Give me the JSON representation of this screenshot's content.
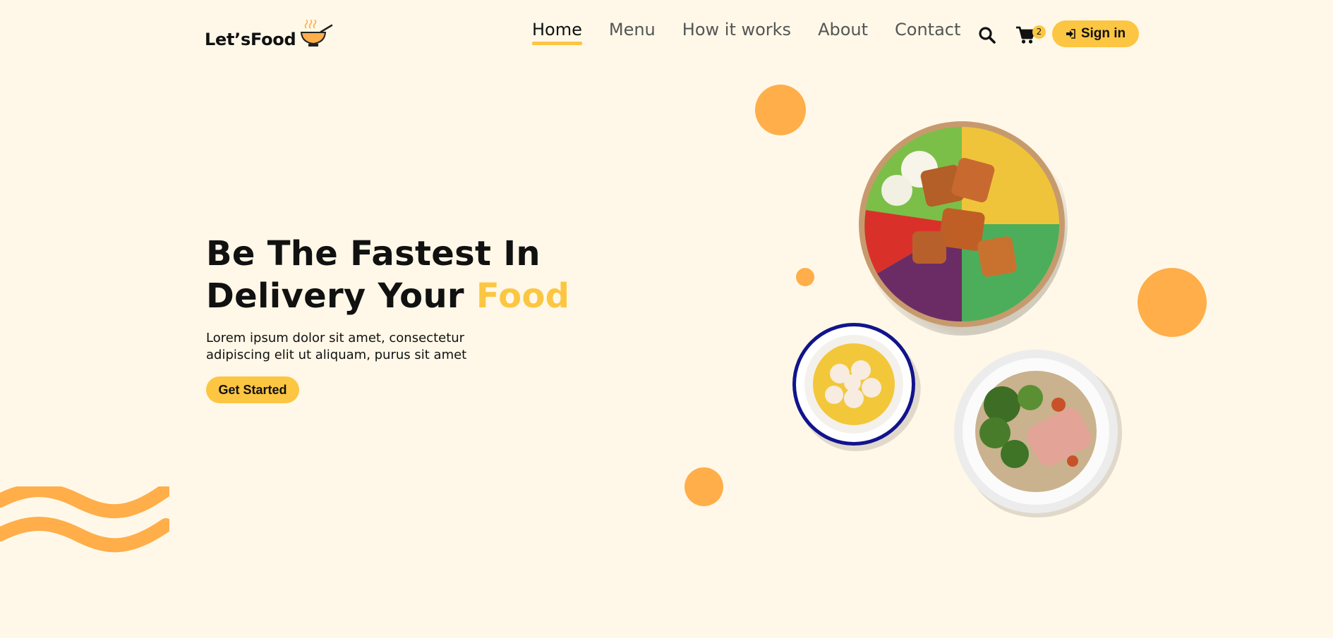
{
  "brand": {
    "name": "Let’sFood",
    "logo_icon": "soup-bowl-icon"
  },
  "nav": {
    "items": [
      {
        "label": "Home",
        "active": true
      },
      {
        "label": "Menu",
        "active": false
      },
      {
        "label": "How it works",
        "active": false
      },
      {
        "label": "About",
        "active": false
      },
      {
        "label": "Contact",
        "active": false
      }
    ]
  },
  "header": {
    "search_icon": "search-icon",
    "cart_icon": "cart-icon",
    "cart_count": "2",
    "signin_icon": "sign-in-icon",
    "signin_label": "Sign in"
  },
  "hero": {
    "title_line1": "Be The Fastest In",
    "title_line2": "Delivery Your",
    "title_accent": "Food",
    "description": "Lorem ipsum dolor sit amet, consectetur adipiscing elit ut aliquam, purus sit amet",
    "cta_label": "Get Started"
  },
  "colors": {
    "background": "#fff8e8",
    "accent_yellow": "#fcc642",
    "accent_orange": "#ffae4a"
  }
}
